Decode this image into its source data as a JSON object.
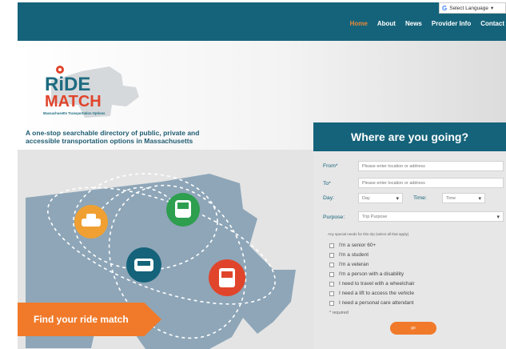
{
  "language": {
    "label": "Select Language"
  },
  "nav": {
    "items": [
      "Home",
      "About",
      "News",
      "Provider Info",
      "Contact"
    ]
  },
  "logo": {
    "word1": "RiDE",
    "word2": "MATCH",
    "sub": "Massachusetts Transportation Options"
  },
  "hero": {
    "tagline": "A one-stop searchable directory of public, private and accessible transportation options in Massachusetts",
    "cta": "Find your ride match"
  },
  "form": {
    "title": "Where are you going?",
    "from_label": "From*",
    "from_placeholder": "Please enter location or address",
    "to_label": "To*",
    "to_placeholder": "Please enter location or address",
    "day_label": "Day:",
    "day_value": "Day",
    "time_label": "Time:",
    "time_value": "Time",
    "purpose_label": "Purpose:",
    "purpose_value": "Trip Purpose",
    "hint": "Any special needs for this trip (select all that apply)",
    "options": [
      "I'm a senior 60+",
      "I'm a student",
      "I'm a veteran",
      "I'm a person with a disability",
      "I need to travel with a wheelchair",
      "I need a lift to access the vehicle",
      "I need a personal care attendant"
    ],
    "required_note": "* required",
    "go_label": "go"
  },
  "colors": {
    "teal": "#15637a",
    "orange": "#f07a2a",
    "green": "#2e9e4f",
    "red": "#e0452c",
    "map": "#8ea6b8"
  }
}
